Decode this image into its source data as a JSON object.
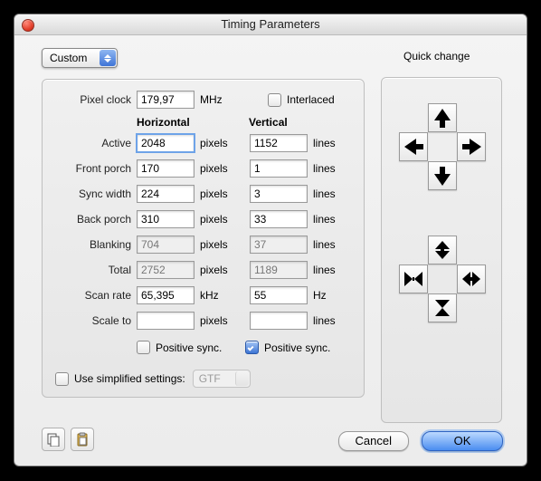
{
  "window": {
    "title": "Timing Parameters"
  },
  "preset": {
    "label": "Custom"
  },
  "pixel_clock": {
    "label": "Pixel clock",
    "value": "179,97",
    "unit": "MHz"
  },
  "interlaced": {
    "label": "Interlaced",
    "checked": false
  },
  "columns": {
    "horizontal": "Horizontal",
    "vertical": "Vertical"
  },
  "rows": {
    "active": "Active",
    "front_porch": "Front porch",
    "sync_width": "Sync width",
    "back_porch": "Back porch",
    "blanking": "Blanking",
    "total": "Total",
    "scan_rate": "Scan rate",
    "scale_to": "Scale to"
  },
  "h": {
    "active": "2048",
    "front_porch": "170",
    "sync_width": "224",
    "back_porch": "310",
    "blanking": "704",
    "total": "2752",
    "scan_rate": "65,395",
    "scale_to": "",
    "unit_px": "pixels",
    "unit_khz": "kHz",
    "positive_sync_label": "Positive sync.",
    "positive_sync_checked": false
  },
  "v": {
    "active": "1152",
    "front_porch": "1",
    "sync_width": "3",
    "back_porch": "33",
    "blanking": "37",
    "total": "1189",
    "scan_rate": "55",
    "scale_to": "",
    "unit_lines": "lines",
    "unit_hz": "Hz",
    "positive_sync_label": "Positive sync.",
    "positive_sync_checked": true
  },
  "simplified": {
    "label": "Use simplified settings:",
    "checked": false,
    "option": "GTF"
  },
  "quick": {
    "title": "Quick change"
  },
  "buttons": {
    "cancel": "Cancel",
    "ok": "OK"
  }
}
